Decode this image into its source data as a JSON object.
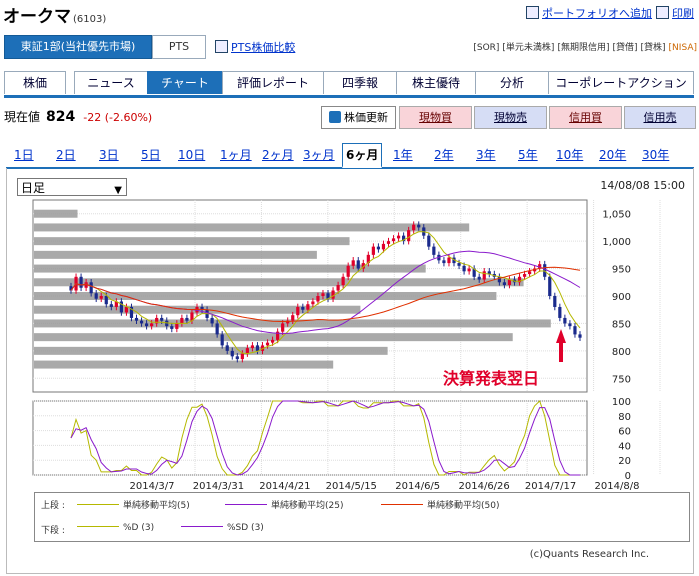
{
  "header": {
    "company": "オークマ",
    "code": "(6103)",
    "portfolio_link": "ポートフォリオへ追加",
    "print_link": "印刷",
    "market_active": "東証1部(当社優先市場)",
    "market_pts": "PTS",
    "pts_compare": "PTS株価比較",
    "badges": [
      "[SOR]",
      "[単元未満株]",
      "[無期限信用]",
      "[貸借]",
      "[貸株]",
      "[NISA]"
    ]
  },
  "tabs": [
    "株価",
    "ニュース",
    "チャート",
    "評価レポート",
    "四季報",
    "株主優待",
    "分析",
    "コーポレートアクション"
  ],
  "active_tab": "チャート",
  "price": {
    "label": "現在値",
    "value": "824",
    "change": "-22 (-2.60%)"
  },
  "buttons": {
    "refresh": "株価更新",
    "buy_spot": "現物買",
    "sell_spot": "現物売",
    "buy_margin": "信用買",
    "sell_margin": "信用売"
  },
  "periods": [
    "1日",
    "2日",
    "3日",
    "5日",
    "10日",
    "1ヶ月",
    "2ヶ月",
    "3ヶ月",
    "6ヶ月",
    "1年",
    "2年",
    "3年",
    "5年",
    "10年",
    "20年",
    "30年"
  ],
  "active_period": "6ヶ月",
  "chart_controls": {
    "select_value": "日足",
    "timestamp": "14/08/08 15:00"
  },
  "chart_data": {
    "type": "candlestick",
    "y_axis_ticks": [
      "1,050",
      "1,000",
      "950",
      "900",
      "850",
      "800",
      "750"
    ],
    "y_range": [
      725,
      1075
    ],
    "x_labels": [
      "2014/3/7",
      "2014/3/31",
      "2014/4/21",
      "2014/5/15",
      "2014/6/5",
      "2014/6/26",
      "2014/7/17",
      "2014/8/8"
    ],
    "closes": [
      910,
      935,
      915,
      925,
      905,
      895,
      900,
      885,
      880,
      890,
      870,
      880,
      860,
      855,
      850,
      845,
      850,
      860,
      855,
      845,
      840,
      850,
      860,
      855,
      870,
      880,
      875,
      860,
      850,
      830,
      810,
      800,
      790,
      785,
      795,
      805,
      810,
      800,
      810,
      815,
      820,
      835,
      850,
      855,
      865,
      880,
      875,
      885,
      890,
      900,
      905,
      895,
      910,
      920,
      935,
      955,
      965,
      950,
      960,
      975,
      990,
      985,
      995,
      1000,
      1005,
      1010,
      1000,
      1020,
      1030,
      1025,
      1010,
      990,
      975,
      965,
      960,
      970,
      960,
      955,
      945,
      950,
      935,
      930,
      945,
      940,
      935,
      925,
      920,
      930,
      925,
      935,
      940,
      945,
      950,
      958,
      935,
      900,
      880,
      860,
      850,
      845,
      830,
      824
    ],
    "annotation": "決算発表翌日",
    "volume_profile": [
      {
        "price": 1050,
        "vol": 0.08
      },
      {
        "price": 1025,
        "vol": 0.8
      },
      {
        "price": 1000,
        "vol": 0.58
      },
      {
        "price": 975,
        "vol": 0.52
      },
      {
        "price": 950,
        "vol": 0.72
      },
      {
        "price": 925,
        "vol": 0.9
      },
      {
        "price": 900,
        "vol": 0.85
      },
      {
        "price": 875,
        "vol": 0.6
      },
      {
        "price": 850,
        "vol": 0.95
      },
      {
        "price": 825,
        "vol": 0.88
      },
      {
        "price": 800,
        "vol": 0.65
      },
      {
        "price": 775,
        "vol": 0.55
      }
    ],
    "osc_ticks": [
      "100",
      "80",
      "60",
      "40",
      "20",
      "0"
    ],
    "legend": {
      "upper_label": "上段 :",
      "lower_label": "下段 :",
      "ma5": "単純移動平均(5)",
      "ma25": "単純移動平均(25)",
      "ma50": "単純移動平均(50)",
      "pd": "%D (3)",
      "psd": "%SD (3)"
    },
    "colors": {
      "up": "#e0002a",
      "down": "#1a2a8c",
      "ma5": "#b5b800",
      "ma25": "#8a1acc",
      "ma50": "#e03000",
      "volume": "#9a9a9a"
    }
  },
  "copyright": "(c)Quants Research Inc."
}
